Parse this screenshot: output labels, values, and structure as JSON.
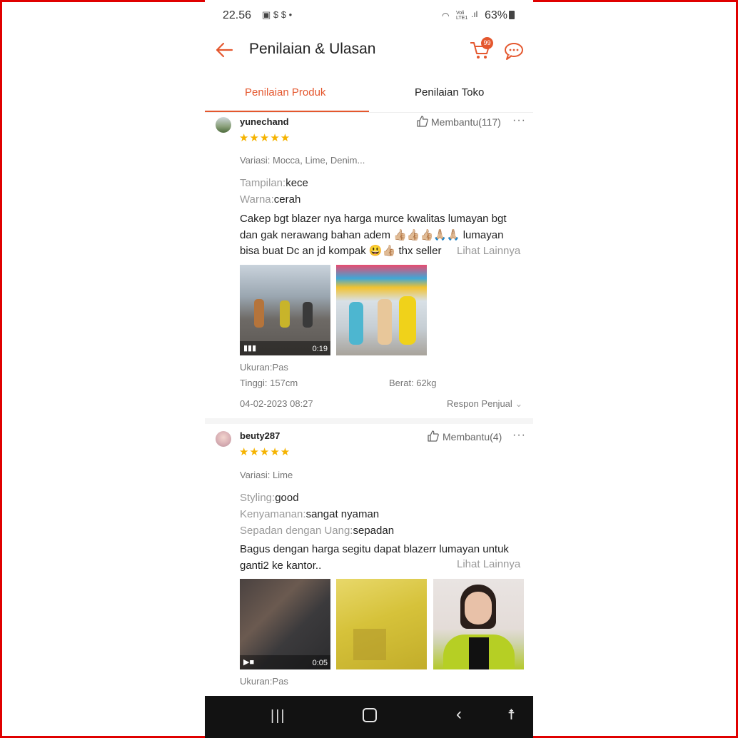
{
  "status_bar": {
    "time": "22.56",
    "network": "Voli LTE1",
    "battery": "63%"
  },
  "header": {
    "title": "Penilaian & Ulasan",
    "cart_count": "99"
  },
  "tabs": [
    {
      "label": "Penilaian Produk"
    },
    {
      "label": "Penilaian Toko"
    }
  ],
  "reviews": [
    {
      "username": "yunechand",
      "stars": "★★★★★",
      "helpful": "Membantu(117)",
      "variation": "Variasi: Mocca, Lime, Denim...",
      "fields": [
        {
          "key": "Tampilan:",
          "value": "kece"
        },
        {
          "key": "Warna:",
          "value": "cerah"
        }
      ],
      "body_lines": [
        "Cakep bgt blazer nya harga murce kwalitas lumayan bgt",
        "dan gak nerawang bahan adem 👍🏼👍🏼👍🏼🙏🏼🙏🏼 lumayan",
        "bisa buat Dc an jd kompak 😃👍🏼 thx seller"
      ],
      "see_more": "Lihat Lainnya",
      "video_duration": "0:19",
      "size": "Ukuran:Pas",
      "height": "Tinggi: 157cm",
      "weight": "Berat: 62kg",
      "date": "04-02-2023 08:27",
      "seller_response": "Respon Penjual"
    },
    {
      "username": "beuty287",
      "stars": "★★★★★",
      "helpful": "Membantu(4)",
      "variation": "Variasi: Lime",
      "fields": [
        {
          "key": "Styling:",
          "value": "good"
        },
        {
          "key": "Kenyamanan:",
          "value": "sangat nyaman"
        },
        {
          "key": "Sepadan dengan Uang:",
          "value": "sepadan"
        }
      ],
      "body_lines": [
        "Bagus dengan harga segitu dapat blazerr lumayan untuk",
        "ganti2 ke kantor.."
      ],
      "see_more": "Lihat Lainnya",
      "video_duration": "0:05",
      "size": "Ukuran:Pas"
    }
  ],
  "colors": {
    "accent": "#e4572e",
    "star": "#f5b300",
    "frame": "#e00000"
  }
}
